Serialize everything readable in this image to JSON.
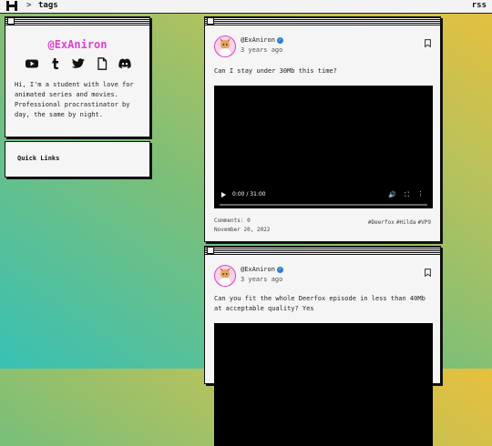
{
  "topbar": {
    "separator": ">",
    "crumb": "tags",
    "rss": "rss"
  },
  "profile": {
    "handle": "@ExAniron",
    "socials": [
      "youtube-icon",
      "tumblr-icon",
      "twitter-icon",
      "file-icon",
      "discord-icon"
    ],
    "bio": "Hi, I'm a student with love for animated series and movies. Professional procrastinator by day, the same by night."
  },
  "quick_links": {
    "label": "Quick Links"
  },
  "posts": [
    {
      "author": "@ExAniron",
      "ago": "3 years ago",
      "text": "Can I stay under 30Mb this time?",
      "video": {
        "time": "0:00 / 31:00"
      },
      "comments": "Comments: 0",
      "date": "November 20, 2022",
      "tags": [
        "#Deerfox",
        "#Hilda",
        "#VP9"
      ]
    },
    {
      "author": "@ExAniron",
      "ago": "3 years ago",
      "text": "Can you fit the whole Deerfox episode in less than 40Mb at acceptable quality? Yes"
    }
  ],
  "colors": {
    "accent": "#e13fd3",
    "verified": "#2b7cd3"
  }
}
